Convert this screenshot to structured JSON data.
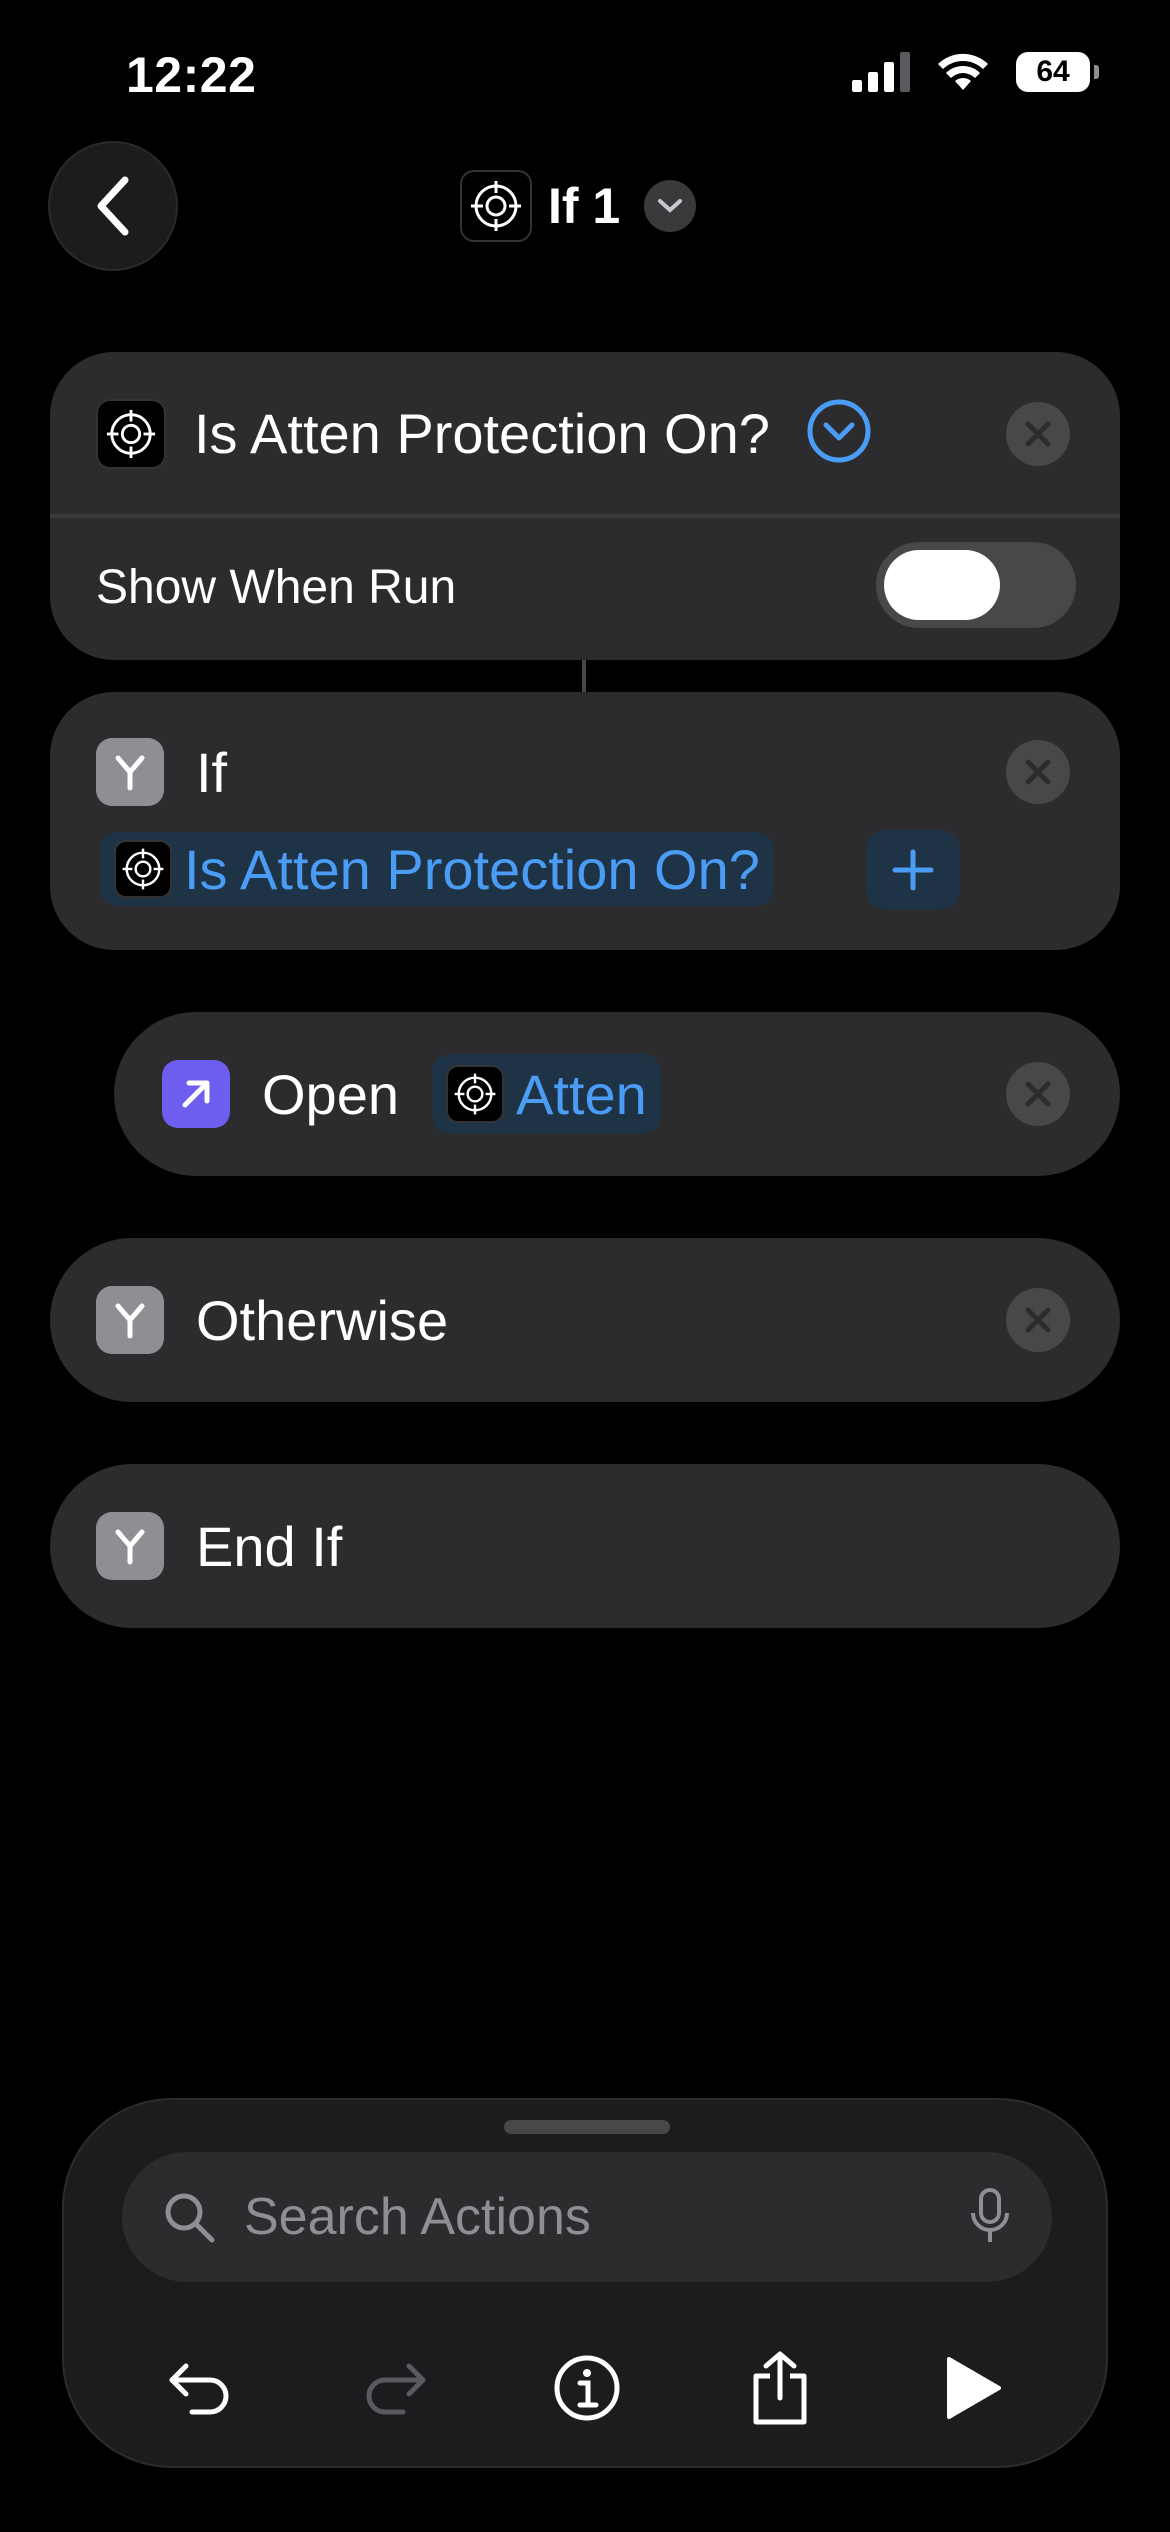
{
  "status_bar": {
    "time": "12:22",
    "battery": "64"
  },
  "nav": {
    "title": "If 1"
  },
  "action_card": {
    "title": "Is Atten Protection On?",
    "show_when_run_label": "Show When Run",
    "show_when_run_on": false
  },
  "if_card": {
    "title": "If",
    "condition_token": "Is Atten Protection On?"
  },
  "open_card": {
    "title": "Open",
    "app_token": "Atten"
  },
  "otherwise_card": {
    "title": "Otherwise"
  },
  "end_if_card": {
    "title": "End If"
  },
  "search": {
    "placeholder": "Search Actions"
  },
  "toolbar": {
    "icons": [
      "undo-icon",
      "redo-icon",
      "info-icon",
      "share-icon",
      "play-icon"
    ]
  },
  "colors": {
    "background": "#000000",
    "card": "#2c2c2e",
    "accent_blue": "#4a9cf5",
    "open_icon": "#6e5ef0",
    "control_grey": "#8e8e93"
  }
}
